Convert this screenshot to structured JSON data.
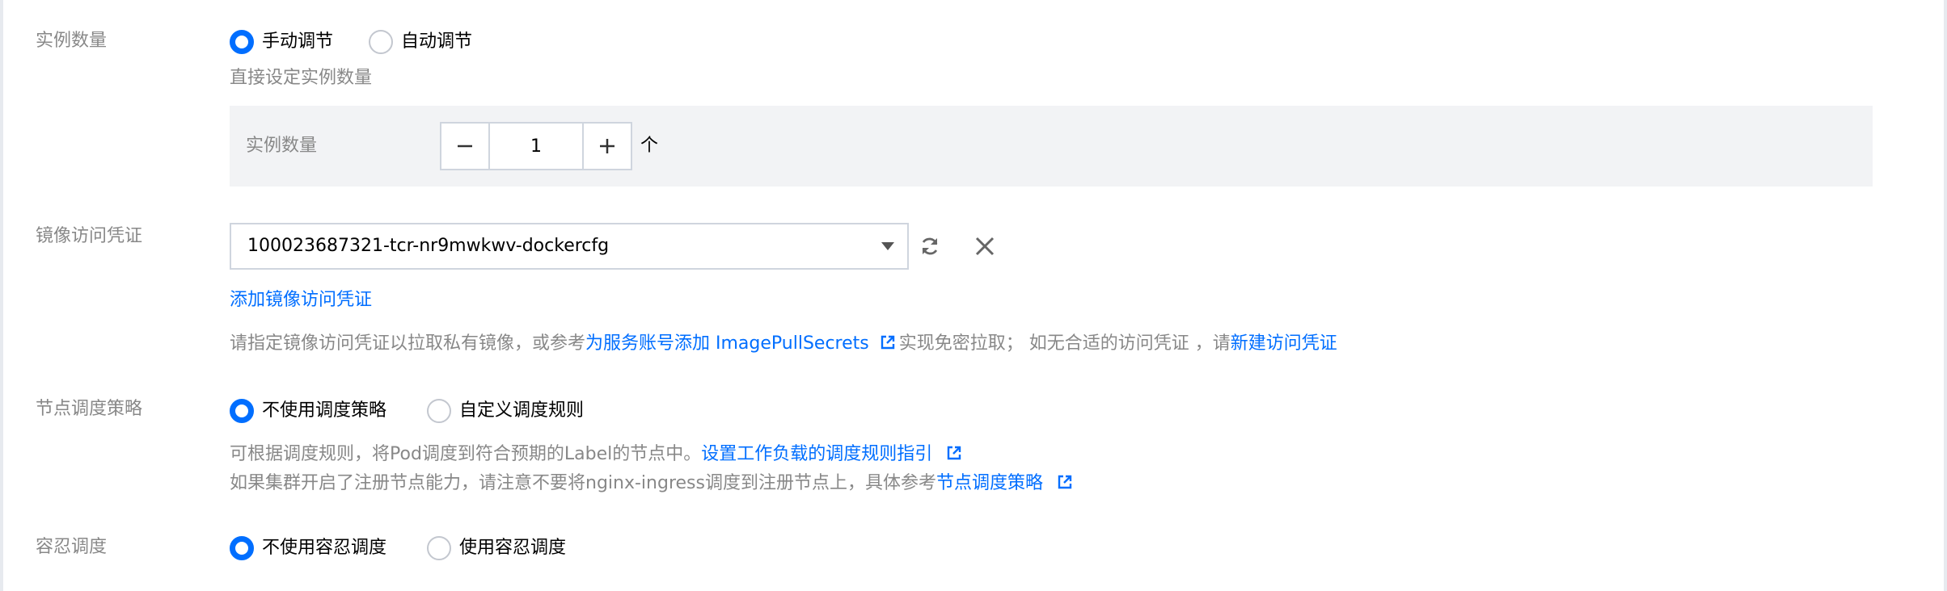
{
  "replicas": {
    "label": "实例数量",
    "options": [
      "手动调节",
      "自动调节"
    ],
    "selected": 0,
    "hint": "直接设定实例数量",
    "panel_label": "实例数量",
    "value": "1",
    "unit": "个"
  },
  "image_pull_secret": {
    "label": "镜像访问凭证",
    "selected_value": "100023687321-tcr-nr9mwkwv-dockercfg",
    "add_link": "添加镜像访问凭证",
    "hint_prefix": "请指定镜像访问凭证以拉取私有镜像，或参考",
    "hint_link1": "为服务账号添加 ImagePullSecrets",
    "hint_middle": "实现免密拉取； 如无合适的访问凭证 ，请",
    "hint_link2": "新建访问凭证"
  },
  "node_scheduling": {
    "label": "节点调度策略",
    "options": [
      "不使用调度策略",
      "自定义调度规则"
    ],
    "selected": 0,
    "hint1_prefix": "可根据调度规则，将Pod调度到符合预期的Label的节点中。",
    "hint1_link": "设置工作负载的调度规则指引",
    "hint2_prefix": "如果集群开启了注册节点能力，请注意不要将nginx-ingress调度到注册节点上，具体参考",
    "hint2_link": "节点调度策略"
  },
  "toleration": {
    "label": "容忍调度",
    "options": [
      "不使用容忍调度",
      "使用容忍调度"
    ],
    "selected": 0
  },
  "colors": {
    "accent": "#006eff",
    "label_gray": "#888888",
    "panel_bg": "#f2f3f5",
    "border": "#cfd5de"
  },
  "icons": {
    "minus": "minus-icon",
    "plus": "plus-icon",
    "refresh": "refresh-icon",
    "close": "close-icon",
    "external_link": "external-link-icon",
    "dropdown": "chevron-down-icon"
  }
}
